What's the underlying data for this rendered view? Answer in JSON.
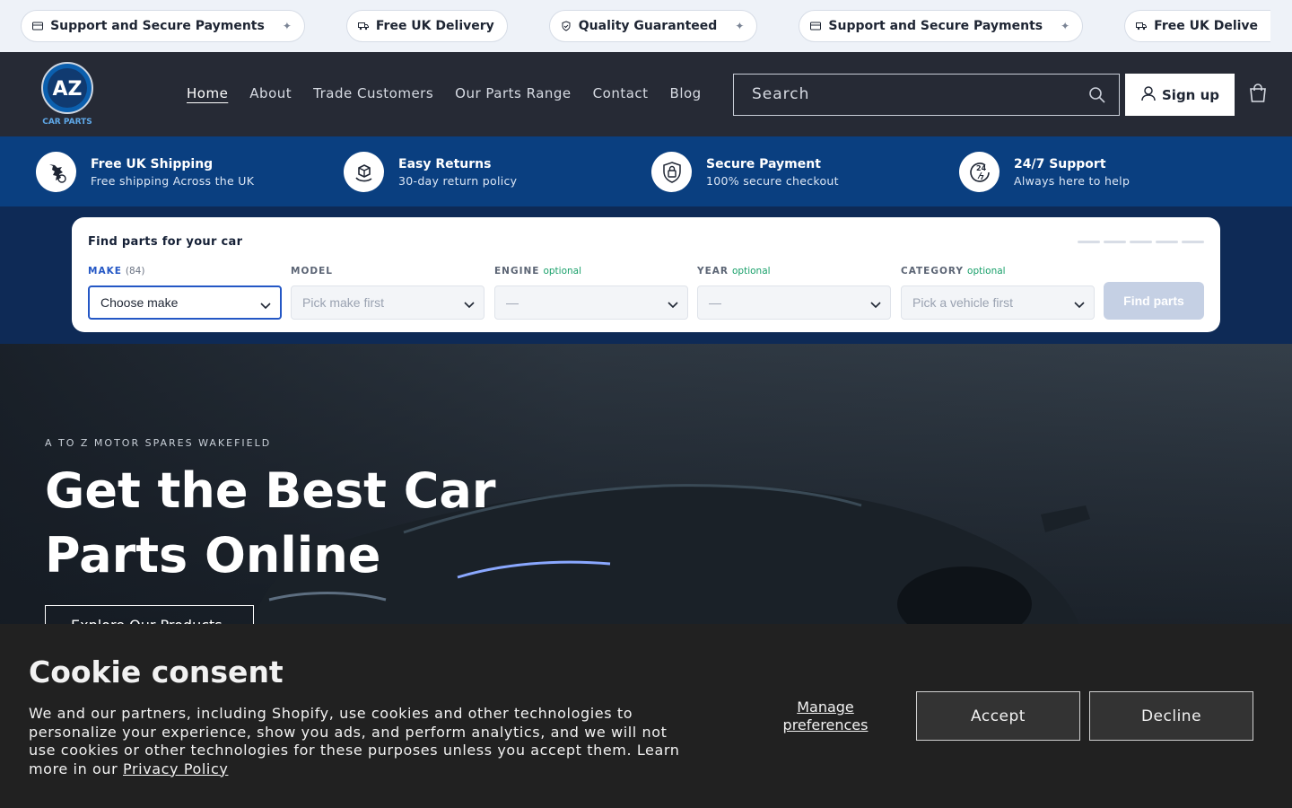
{
  "marquee": {
    "items": [
      {
        "icon": "check-shield-icon",
        "label": "Quality Guaranteed",
        "visible": "ranteed"
      },
      {
        "icon": "card-icon",
        "label": "Support and Secure Payments"
      },
      {
        "icon": "truck-icon",
        "label": "Free UK Delivery"
      },
      {
        "icon": "check-shield-icon",
        "label": "Quality Guaranteed"
      },
      {
        "icon": "card-icon",
        "label": "Support and Secure Payments"
      },
      {
        "icon": "truck-icon",
        "label": "Free UK Delivery",
        "visible": "Free UK Delive"
      }
    ]
  },
  "header": {
    "logo_text": "AZ",
    "logo_sub": "CAR PARTS",
    "nav": [
      "Home",
      "About",
      "Trade Customers",
      "Our Parts Range",
      "Contact",
      "Blog"
    ],
    "search_placeholder": "Search",
    "signup_label": "Sign up"
  },
  "features": [
    {
      "title": "Free UK Shipping",
      "desc": "Free shipping Across the UK",
      "icon": "uk-shipping-icon"
    },
    {
      "title": "Easy Returns",
      "desc": "30-day return policy",
      "icon": "returns-box-icon"
    },
    {
      "title": "Secure Payment",
      "desc": "100% secure checkout",
      "icon": "secure-lock-icon"
    },
    {
      "title": "24/7 Support",
      "desc": "Always here to help",
      "icon": "support-24-7-icon"
    }
  ],
  "finder": {
    "title": "Find parts for your car",
    "make": {
      "label": "MAKE",
      "count": "(84)",
      "value": "Choose make"
    },
    "model": {
      "label": "MODEL",
      "value": "Pick make first"
    },
    "engine": {
      "label": "ENGINE",
      "optional": "optional",
      "value": "—"
    },
    "year": {
      "label": "YEAR",
      "optional": "optional",
      "value": "—"
    },
    "category": {
      "label": "CATEGORY",
      "optional": "optional",
      "value": "Pick a vehicle first"
    },
    "button": "Find parts"
  },
  "hero": {
    "kicker": "A TO Z MOTOR SPARES WAKEFIELD",
    "heading": "Get the Best Car Parts Online",
    "button": "Explore Our Products"
  },
  "cookie": {
    "title": "Cookie consent",
    "body": "We and our partners, including Shopify, use cookies and other technologies to personalize your experience, show you ads, and perform analytics, and we will not use cookies or other technologies for these purposes unless you accept them. Learn more in our",
    "link": "Privacy Policy",
    "manage": "Manage preferences",
    "accept": "Accept",
    "decline": "Decline"
  }
}
